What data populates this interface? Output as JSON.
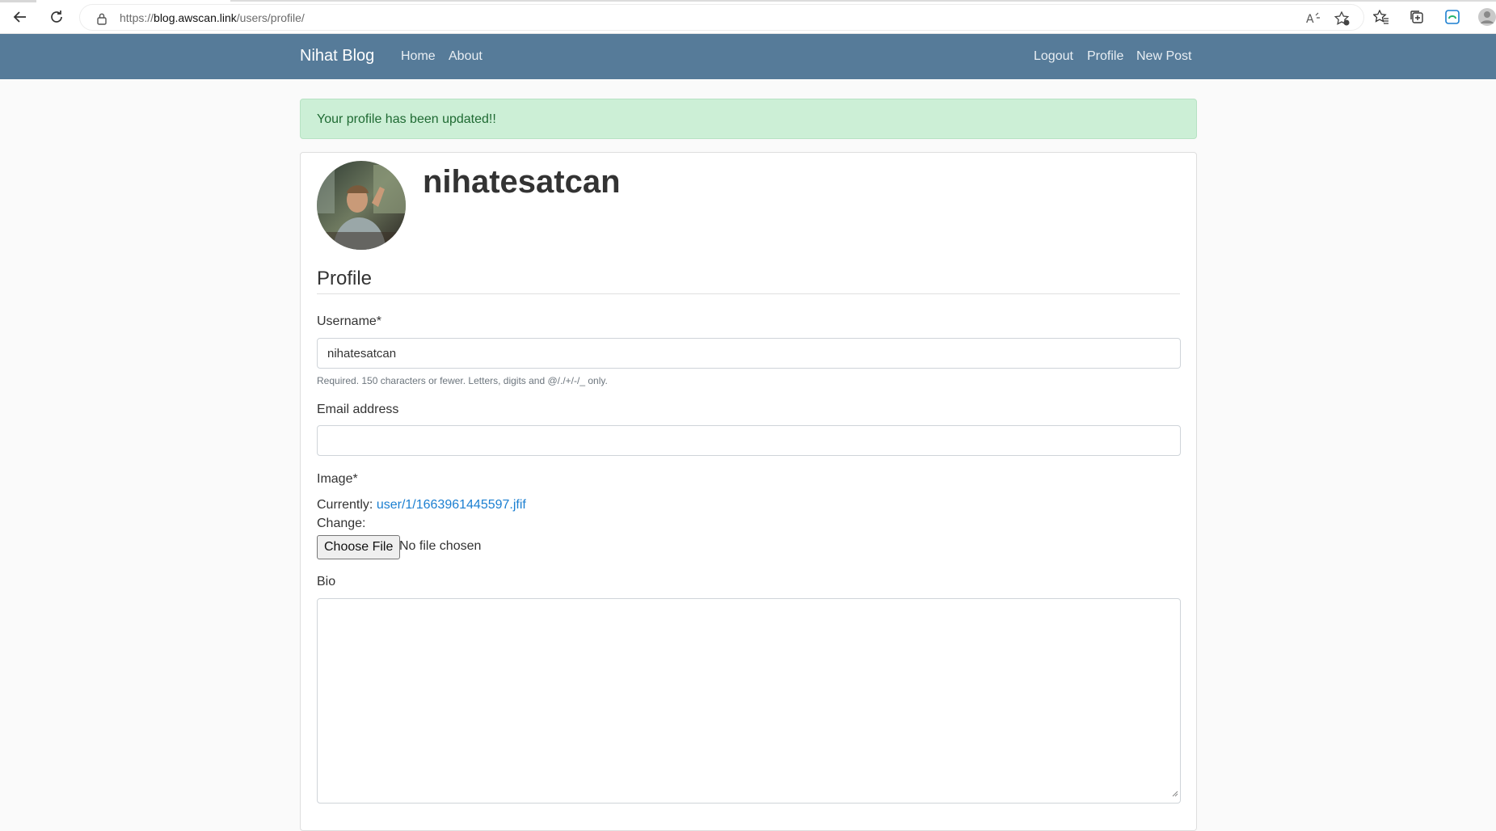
{
  "browser": {
    "url_protocol": "https://",
    "url_host": "blog.awscan.link",
    "url_path": "/users/profile/"
  },
  "navbar": {
    "brand": "Nihat Blog",
    "left_links": [
      "Home",
      "About"
    ],
    "right_links": [
      "Logout",
      "Profile",
      "New Post"
    ]
  },
  "alert": {
    "message": "Your profile has been updated!!"
  },
  "profile": {
    "username_heading": "nihatesatcan",
    "legend": "Profile",
    "username_label": "Username*",
    "username_value": "nihatesatcan",
    "username_help": "Required. 150 characters or fewer. Letters, digits and @/./+/-/_ only.",
    "email_label": "Email address",
    "email_value": "",
    "image_label": "Image*",
    "currently_label": "Currently:",
    "current_image": "user/1/1663961445597.jfif",
    "change_label": "Change:",
    "choose_file_label": "Choose File",
    "no_file_text": "No file chosen",
    "bio_label": "Bio"
  },
  "colors": {
    "navbar": "#567b99",
    "alert_bg": "#ccefd6",
    "alert_text": "#1f6a33",
    "link": "#1b7fd1"
  },
  "icons": [
    "back-arrow-icon",
    "refresh-icon",
    "lock-icon",
    "read-aloud-icon",
    "add-favorite-icon",
    "favorites-icon",
    "collections-icon",
    "edge-icon",
    "profile-avatar-icon"
  ]
}
